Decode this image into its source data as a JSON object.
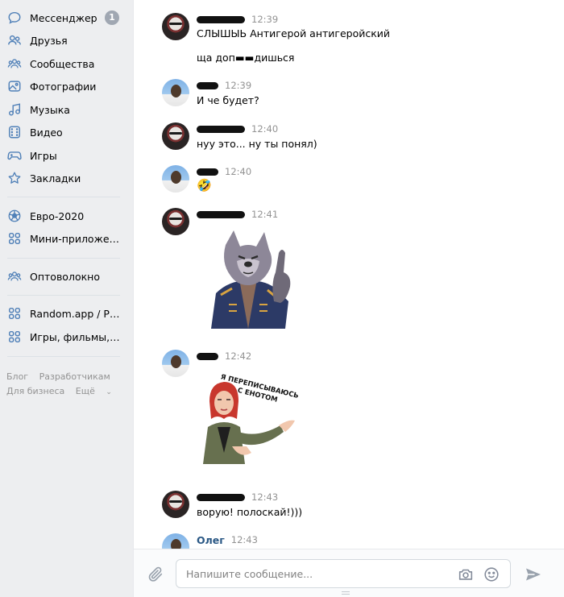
{
  "sidebar": {
    "items": [
      {
        "label": "Мессенджер",
        "icon": "message-bubble-icon",
        "badge": "1"
      },
      {
        "label": "Друзья",
        "icon": "friends-icon"
      },
      {
        "label": "Сообщества",
        "icon": "communities-icon"
      },
      {
        "label": "Фотографии",
        "icon": "photos-icon"
      },
      {
        "label": "Музыка",
        "icon": "music-note-icon"
      },
      {
        "label": "Видео",
        "icon": "video-icon"
      },
      {
        "label": "Игры",
        "icon": "gamepad-icon"
      },
      {
        "label": "Закладки",
        "icon": "star-icon"
      },
      {
        "label": "Евро-2020",
        "icon": "football-icon"
      },
      {
        "label": "Мини-приложения",
        "icon": "apps-grid-icon"
      },
      {
        "label": "Оптоволокно",
        "icon": "communities-icon"
      },
      {
        "label": "Random.app / Роз...",
        "icon": "apps-grid-icon"
      },
      {
        "label": "Игры, фильмы, му...",
        "icon": "apps-grid-icon"
      }
    ],
    "footer": {
      "blog": "Блог",
      "developers": "Разработчикам",
      "business": "Для бизнеса",
      "more": "Ещё"
    }
  },
  "messages": [
    {
      "author": "",
      "time": "12:39",
      "avatar": "joker",
      "lines": [
        "СЛЫШЫЬ Антигерой антигеройский",
        "ща доп▬▬дишься"
      ]
    },
    {
      "author": "",
      "time": "12:39",
      "avatar": "oleg",
      "lines": [
        "И че будет?"
      ]
    },
    {
      "author": "",
      "time": "12:40",
      "avatar": "joker",
      "lines": [
        "нуу это... ну ты понял)"
      ]
    },
    {
      "author": "",
      "time": "12:40",
      "avatar": "oleg",
      "emoji": "🤣"
    },
    {
      "author": "",
      "time": "12:41",
      "avatar": "joker",
      "sticker": "wolf-sticker"
    },
    {
      "author": "",
      "time": "12:42",
      "avatar": "oleg",
      "sticker": "girl-sticker",
      "sticker_text": [
        "Я ПЕРЕПИСЫВАЮСЬ",
        "С ЕНОТОМ"
      ]
    },
    {
      "author": "",
      "time": "12:43",
      "avatar": "joker",
      "lines": [
        "ворую! полоскай!)))"
      ]
    },
    {
      "author": "Олег",
      "time": "12:43",
      "avatar": "oleg"
    }
  ],
  "composer": {
    "placeholder": "Напишите сообщение...",
    "value": ""
  },
  "colors": {
    "accent": "#5181b8",
    "link": "#2a5885",
    "sidebar_bg": "#edeef0",
    "muted": "#939393"
  }
}
